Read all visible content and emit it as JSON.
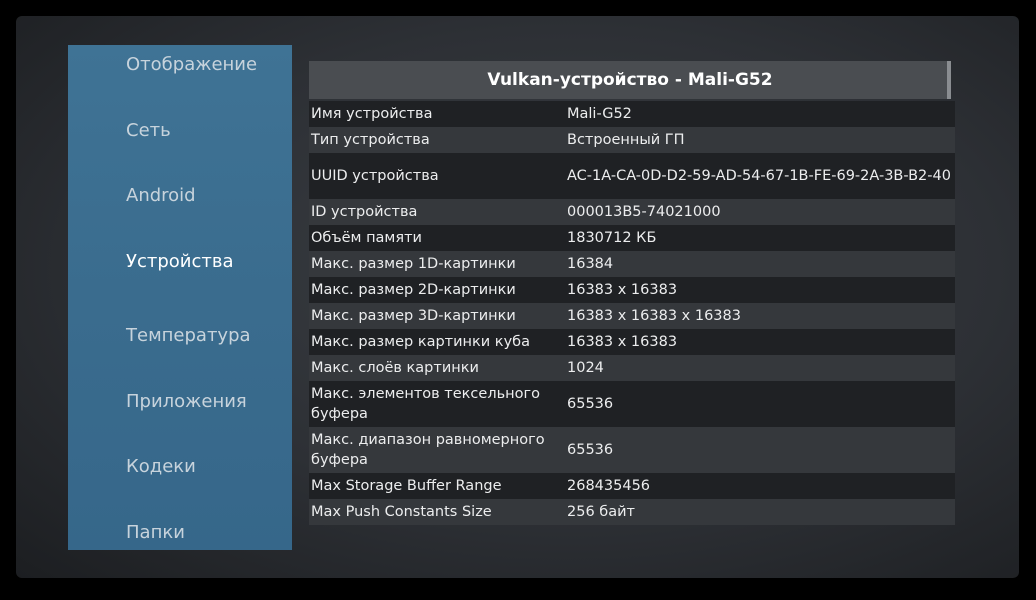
{
  "sidebar": {
    "items": [
      {
        "label": "Отображение",
        "active": false
      },
      {
        "label": "Сеть",
        "active": false
      },
      {
        "label": "Android",
        "active": false
      },
      {
        "label": "Устройства",
        "active": true
      },
      {
        "label": "Температура",
        "active": false
      },
      {
        "label": "Приложения",
        "active": false
      },
      {
        "label": "Кодеки",
        "active": false
      },
      {
        "label": "Папки",
        "active": false
      }
    ]
  },
  "panel": {
    "title": "Vulkan-устройство - Mali-G52",
    "rows": [
      {
        "key": "Имя устройства",
        "value": "Mali-G52"
      },
      {
        "key": "Тип устройства",
        "value": "Встроенный ГП"
      },
      {
        "key": "UUID устройства",
        "value": "AC-1A-CA-0D-D2-59-AD-54-67-1B-FE-69-2A-3B-B2-40"
      },
      {
        "key": "ID устройства",
        "value": "000013B5-74021000"
      },
      {
        "key": "Объём памяти",
        "value": "1830712 КБ"
      },
      {
        "key": "Макс. размер 1D-картинки",
        "value": "16384"
      },
      {
        "key": "Макс. размер 2D-картинки",
        "value": "16383 x 16383"
      },
      {
        "key": "Макс. размер 3D-картинки",
        "value": "16383 x 16383 x 16383"
      },
      {
        "key": "Макс. размер картинки куба",
        "value": "16383 x 16383"
      },
      {
        "key": "Макс. слоёв картинки",
        "value": "1024"
      },
      {
        "key": "Макс. элементов тексельного буфера",
        "value": "65536"
      },
      {
        "key": "Макс. диапазон равномерного буфера",
        "value": "65536"
      },
      {
        "key": "Max Storage Buffer Range",
        "value": "268435456"
      },
      {
        "key": "Max Push Constants Size",
        "value": "256 байт"
      }
    ]
  }
}
